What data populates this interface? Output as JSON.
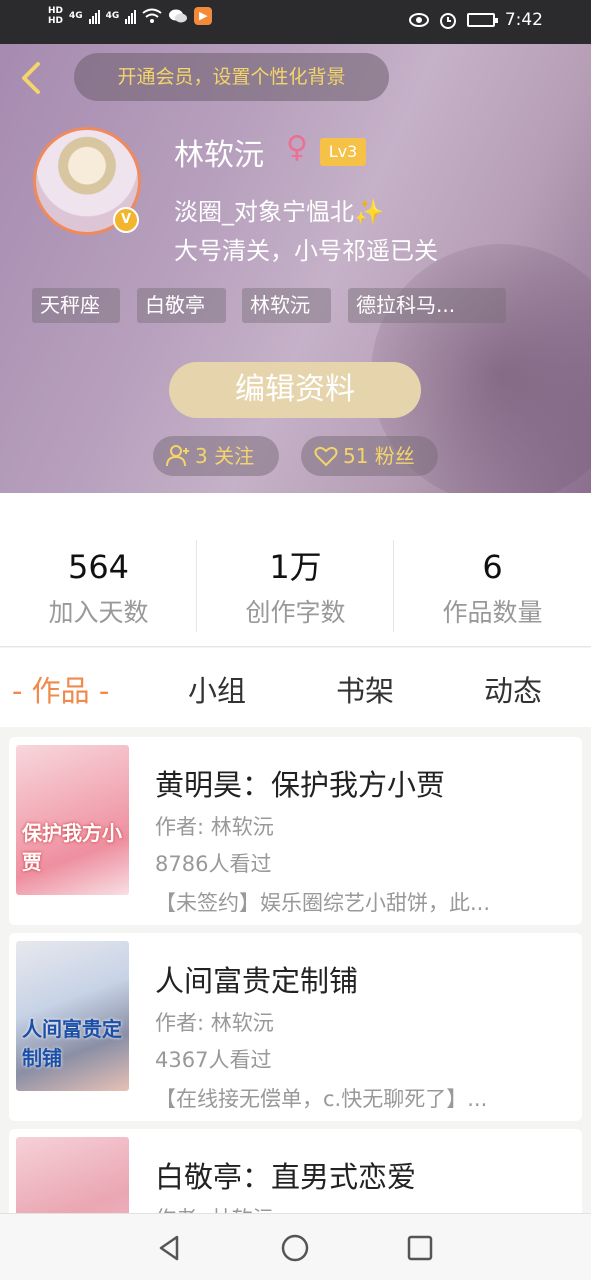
{
  "status_bar": {
    "hd1": "HD",
    "hd2": "HD",
    "net1": "4G",
    "net2": "4G",
    "time": "7:42"
  },
  "header": {
    "vip_banner": "开通会员，设置个性化背景",
    "username": "林软沅",
    "gender_symbol": "♀",
    "level": "Lv3",
    "avatar_badge": "V",
    "bio_line1": "淡圈_对象宁愠北",
    "bio_sparkle": "✨",
    "bio_line2": "大号清关，小号祁遥已关",
    "tags": [
      "天秤座",
      "白敬亭",
      "林软沅",
      "德拉科马..."
    ],
    "edit_button": "编辑资料",
    "following": "3 关注",
    "followers": "51 粉丝",
    "accent_color": "#f3d56a"
  },
  "stats": [
    {
      "value": "564",
      "label": "加入天数"
    },
    {
      "value": "1万",
      "label": "创作字数"
    },
    {
      "value": "6",
      "label": "作品数量"
    }
  ],
  "tabs": [
    {
      "label": "- 作品 -",
      "active": true
    },
    {
      "label": "小组",
      "active": false
    },
    {
      "label": "书架",
      "active": false
    },
    {
      "label": "动态",
      "active": false
    }
  ],
  "books": [
    {
      "title": "黄明昊：保护我方小贾",
      "author": "作者: 林软沅",
      "views": "8786人看过",
      "description": "【未签约】娱乐圈综艺小甜饼，此...",
      "cover_text": "保护我方小贾"
    },
    {
      "title": "人间富贵定制铺",
      "author": "作者: 林软沅",
      "views": "4367人看过",
      "description": "【在线接无偿单，c.快无聊死了】...",
      "cover_text": "人间富贵定制铺"
    },
    {
      "title": "白敬亭：直男式恋爱",
      "author": "作者: 林软沅",
      "views": "",
      "description": "",
      "cover_text": ""
    }
  ],
  "theme": {
    "active_tab_color": "#ef8a4b",
    "level_color": "#f5c146",
    "avatar_border": "#f08a5d"
  }
}
